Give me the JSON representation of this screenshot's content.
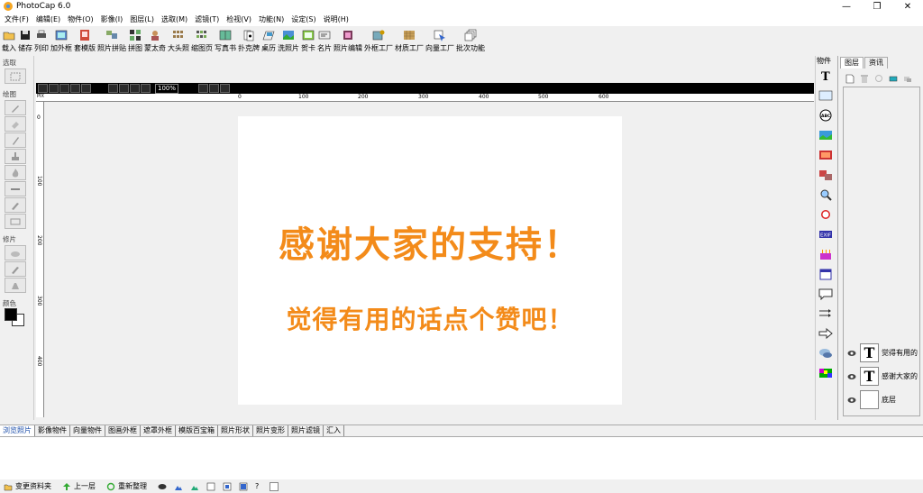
{
  "window": {
    "title": "PhotoCap 6.0",
    "minimize": "—",
    "maximize": "❐",
    "close": "✕"
  },
  "menu": [
    "文件(F)",
    "编辑(E)",
    "物件(O)",
    "影像(I)",
    "图层(L)",
    "选取(M)",
    "滤镜(T)",
    "检视(V)",
    "功能(N)",
    "设定(S)",
    "说明(H)"
  ],
  "toolbar": [
    {
      "label": "载入",
      "icon": "open-folder-icon"
    },
    {
      "label": "储存",
      "icon": "save-disk-icon"
    },
    {
      "label": "列印",
      "icon": "printer-icon"
    },
    {
      "label": "加外框",
      "icon": "frame-icon"
    },
    {
      "label": "套模版",
      "icon": "template-icon"
    },
    {
      "label": "照片拼贴",
      "icon": "collage-icon"
    },
    {
      "label": "拼图",
      "icon": "puzzle-icon"
    },
    {
      "label": "蒙太奇",
      "icon": "montage-icon"
    },
    {
      "label": "大头照",
      "icon": "id-photo-icon"
    },
    {
      "label": "缩图页",
      "icon": "thumbnail-page-icon"
    },
    {
      "label": "写真书",
      "icon": "photo-book-icon"
    },
    {
      "label": "扑克牌",
      "icon": "poker-card-icon"
    },
    {
      "label": "桌历",
      "icon": "desk-calendar-icon"
    },
    {
      "label": "洗照片",
      "icon": "print-photo-icon"
    },
    {
      "label": "贺卡",
      "icon": "greeting-card-icon"
    },
    {
      "label": "名片",
      "icon": "business-card-icon"
    },
    {
      "label": "照片编辑",
      "icon": "photo-edit-icon"
    },
    {
      "label": "外框工厂",
      "icon": "frame-factory-icon"
    },
    {
      "label": "材质工厂",
      "icon": "texture-factory-icon"
    },
    {
      "label": "向量工厂",
      "icon": "vector-factory-icon"
    },
    {
      "label": "批次功能",
      "icon": "batch-icon"
    }
  ],
  "left_panel": {
    "select_label": "选取",
    "draw_label": "绘图",
    "repair_label": "修片",
    "color_label": "颜色"
  },
  "editor": {
    "zoom": "100%",
    "ruler_unit": "PIX",
    "ruler_top": [
      "0",
      "100",
      "200",
      "300",
      "400",
      "500",
      "600"
    ],
    "ruler_left": [
      "0",
      "100",
      "200",
      "300",
      "400"
    ]
  },
  "canvas": {
    "line1": "感谢大家的支持！",
    "line2": "觉得有用的话点个赞吧！",
    "text_color": "#f38b1a"
  },
  "object_panel": {
    "header": "物件"
  },
  "layer_panel": {
    "tabs": [
      "图层",
      "资讯"
    ],
    "layers": [
      {
        "name": "觉得有用的",
        "thumb": "T"
      },
      {
        "name": "感谢大家的",
        "thumb": "T"
      },
      {
        "name": "底层",
        "thumb": ""
      }
    ]
  },
  "bottom_tabs": [
    "浏览照片",
    "影像物件",
    "向量物件",
    "图画外框",
    "遮罩外框",
    "模版百宝箱",
    "照片形状",
    "照片变形",
    "照片滤镜",
    "汇入"
  ],
  "status": {
    "change_folder": "变更资料夹",
    "up_level": "上一层",
    "reorganize": "重新整理",
    "help": "?"
  }
}
